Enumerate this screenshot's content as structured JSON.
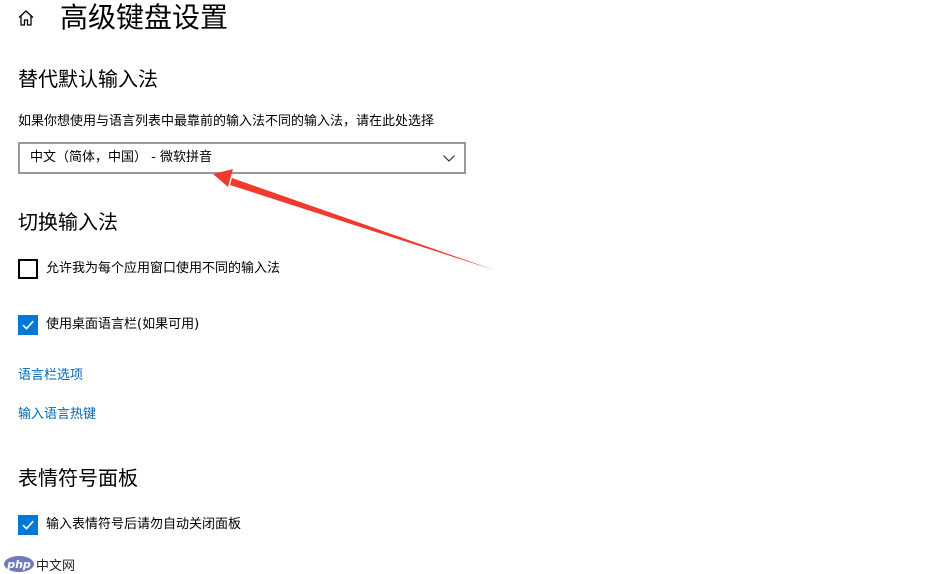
{
  "header": {
    "home_icon": "home-icon",
    "title": "高级键盘设置"
  },
  "override_input": {
    "title": "替代默认输入法",
    "description": "如果你想使用与语言列表中最靠前的输入法不同的输入法，请在此处选择",
    "select_value": "中文（简体，中国） - 微软拼音"
  },
  "switch_input": {
    "title": "切换输入法",
    "options": [
      {
        "label": "允许我为每个应用窗口使用不同的输入法",
        "checked": false
      },
      {
        "label": "使用桌面语言栏(如果可用)",
        "checked": true
      }
    ],
    "links": [
      {
        "label": "语言栏选项"
      },
      {
        "label": "输入语言热键"
      }
    ]
  },
  "emoji_panel": {
    "title": "表情符号面板",
    "options": [
      {
        "label": "输入表情符号后请勿自动关闭面板",
        "checked": true
      }
    ]
  },
  "colors": {
    "accent": "#0078d7",
    "link": "#0067b8",
    "annotation_arrow": "#f03a2e"
  },
  "watermark": {
    "logo_text": "php",
    "text": "中文网"
  }
}
